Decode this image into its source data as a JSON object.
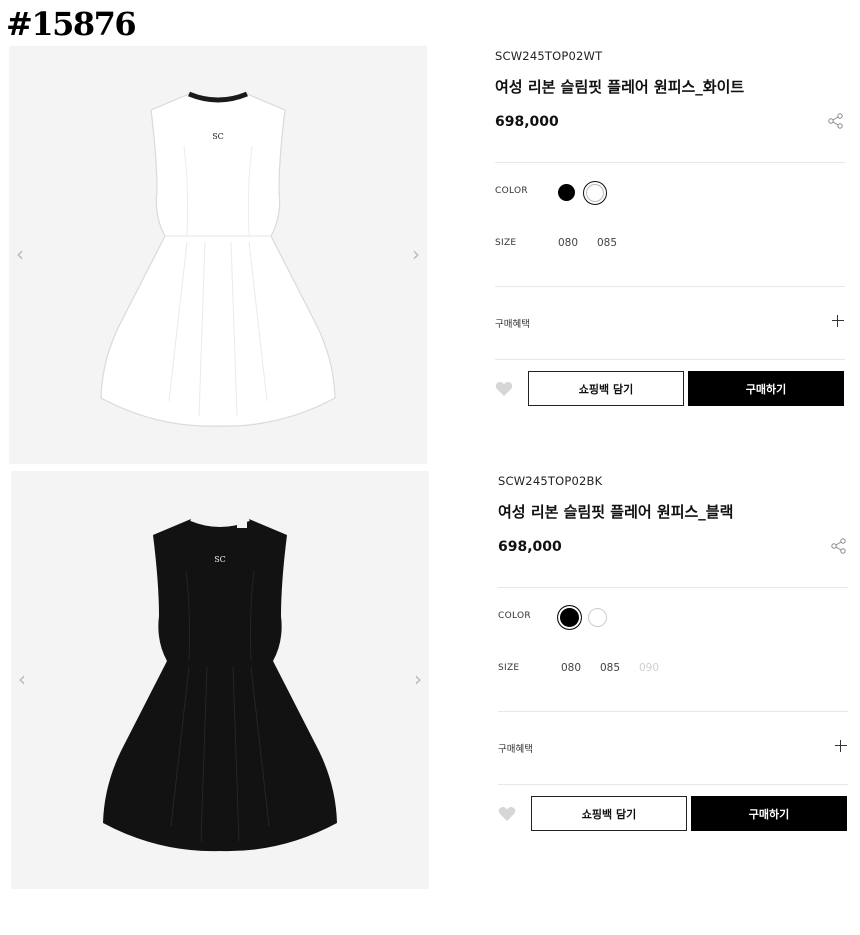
{
  "page_tag": "#15876",
  "products": [
    {
      "code": "SCW245TOP02WT",
      "name": "여성 리본 슬림핏 플레어 원피스_화이트",
      "price": "698,000",
      "color_label": "COLOR",
      "colors": [
        {
          "name": "black",
          "hex": "#000000",
          "selected": false
        },
        {
          "name": "white",
          "hex": "#ffffff",
          "selected": true
        }
      ],
      "size_label": "SIZE",
      "sizes": [
        {
          "label": "080",
          "available": true
        },
        {
          "label": "085",
          "available": true
        }
      ],
      "benefit_label": "구매혜택",
      "cart_label": "쇼핑백 담기",
      "buy_label": "구매하기",
      "image": {
        "dress_color": "#ffffff",
        "trim_color": "#1a1a1a",
        "logo": "SC"
      }
    },
    {
      "code": "SCW245TOP02BK",
      "name": "여성 리본 슬림핏 플레어 원피스_블랙",
      "price": "698,000",
      "color_label": "COLOR",
      "colors": [
        {
          "name": "black",
          "hex": "#000000",
          "selected": true
        },
        {
          "name": "white",
          "hex": "#ffffff",
          "selected": false
        }
      ],
      "size_label": "SIZE",
      "sizes": [
        {
          "label": "080",
          "available": true
        },
        {
          "label": "085",
          "available": true
        },
        {
          "label": "090",
          "available": false
        }
      ],
      "benefit_label": "구매혜택",
      "cart_label": "쇼핑백 담기",
      "buy_label": "구매하기",
      "image": {
        "dress_color": "#121212",
        "trim_color": "#f2f2f2",
        "logo": "SC"
      }
    }
  ]
}
